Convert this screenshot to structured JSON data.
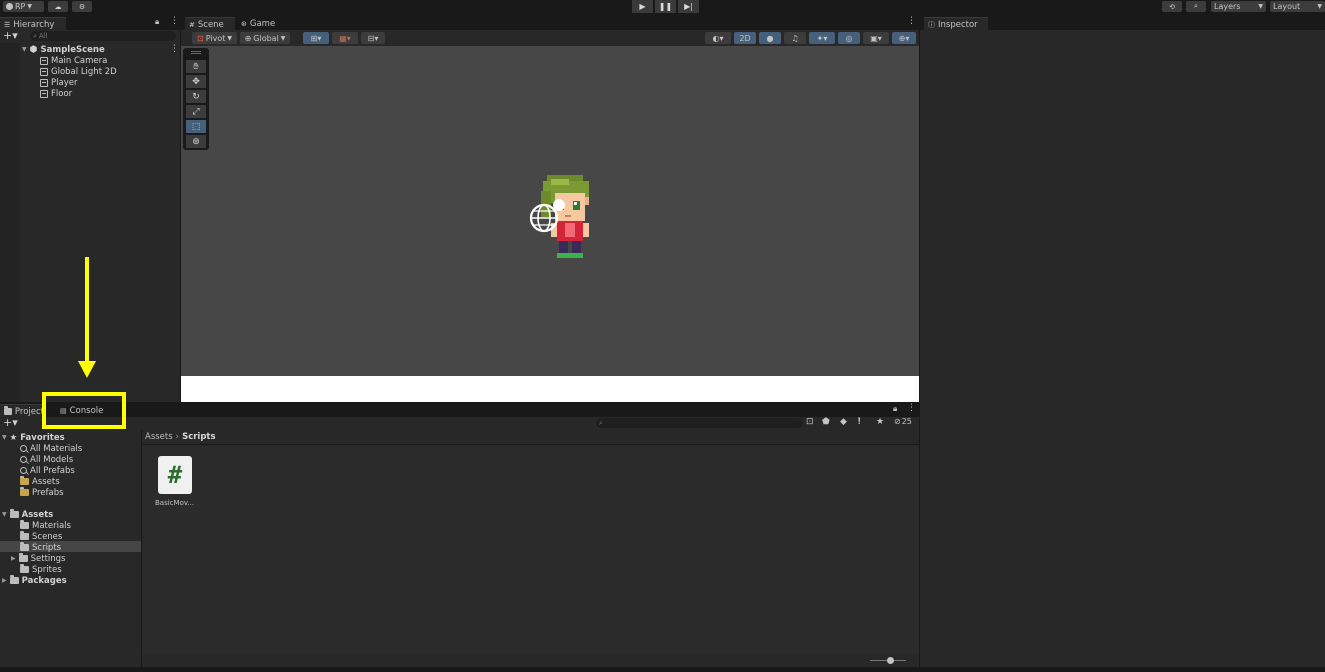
{
  "toolbar": {
    "account_label": "RP",
    "layers_label": "Layers",
    "layout_label": "Layout"
  },
  "hierarchy": {
    "tab_label": "Hierarchy",
    "search_placeholder": "All",
    "scene_name": "SampleScene",
    "objects": [
      "Main Camera",
      "Global Light 2D",
      "Player",
      "Floor"
    ]
  },
  "scene": {
    "tabs": [
      "Scene",
      "Game"
    ],
    "pivot_label": "Pivot",
    "global_label": "Global",
    "mode_2d_label": "2D"
  },
  "inspector": {
    "tab_label": "Inspector"
  },
  "bottom": {
    "tabs": [
      "Project",
      "Console"
    ],
    "breadcrumb": [
      "Assets",
      "Scripts"
    ],
    "hidden_count": "25",
    "asset_name": "BasicMov...",
    "favorites_label": "Favorites",
    "favorites": [
      "All Materials",
      "All Models",
      "All Prefabs",
      "Assets",
      "Prefabs"
    ],
    "assets_label": "Assets",
    "asset_folders": [
      "Materials",
      "Scenes",
      "Scripts",
      "Settings",
      "Sprites"
    ],
    "packages_label": "Packages",
    "selected_folder": "Scripts"
  },
  "annotation": {
    "highlight_color": "#ffff00"
  }
}
